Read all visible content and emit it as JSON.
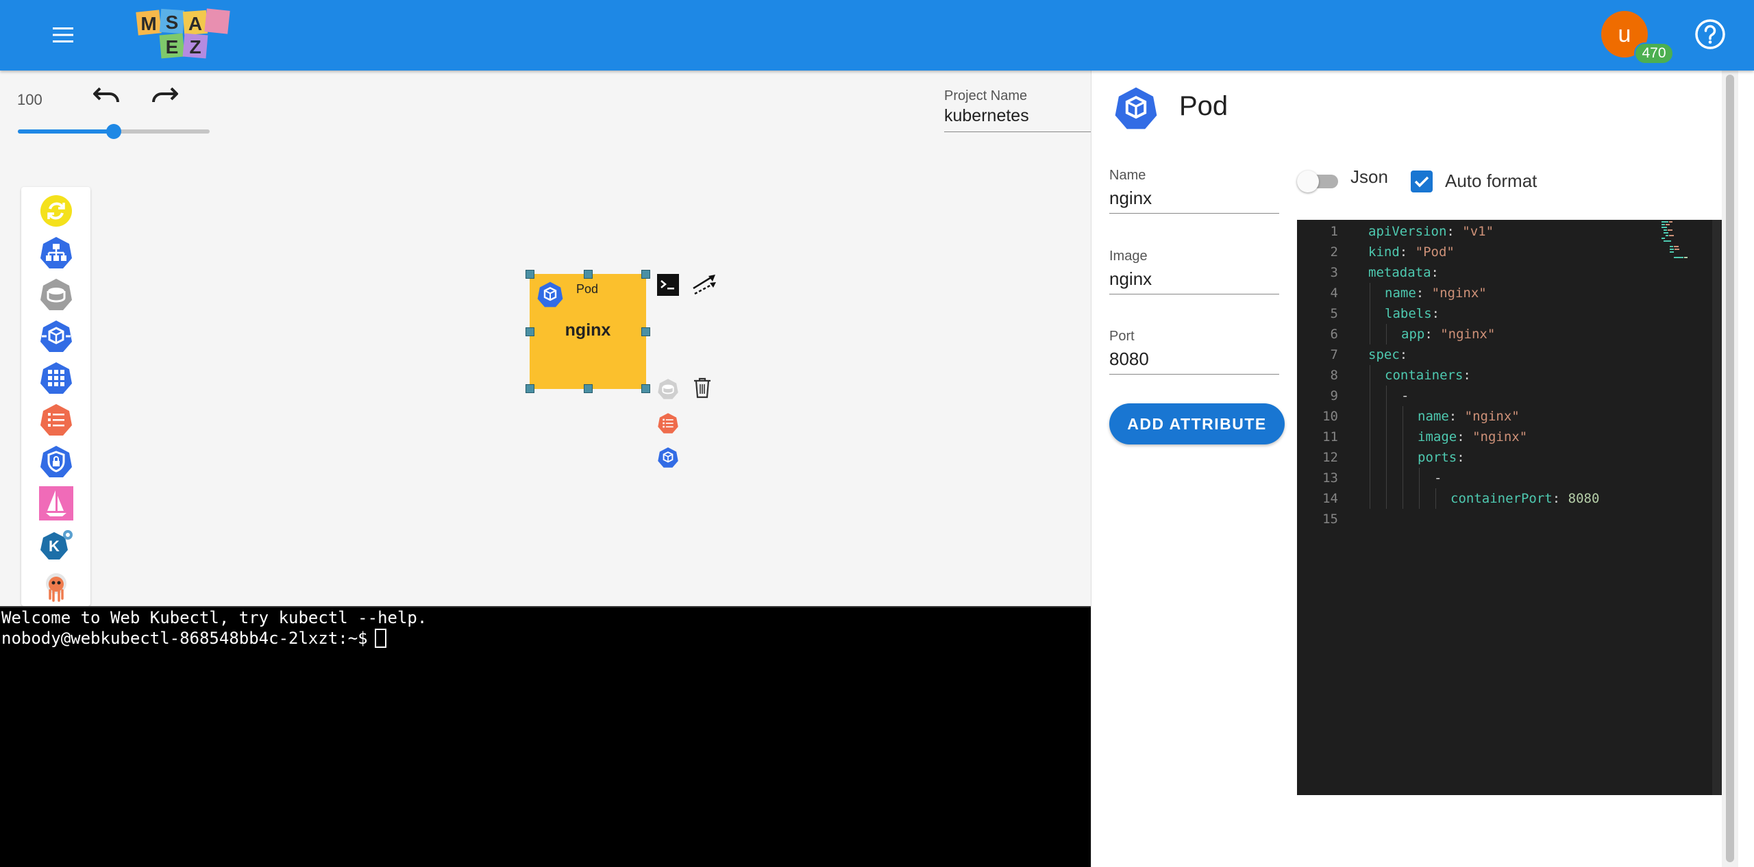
{
  "header": {
    "logo_letters": [
      "M",
      "S",
      "A",
      "E",
      "Z"
    ],
    "avatar_letter": "u",
    "avatar_badge": "470",
    "icons": {
      "menu": "hamburger-menu-icon",
      "help": "help-circle-icon"
    }
  },
  "toolbar": {
    "zoom_value": "100",
    "zoom_level": 0.5,
    "icons": {
      "undo": "undo-icon",
      "redo": "redo-icon"
    }
  },
  "project": {
    "label": "Project Name",
    "value": "kubernetes"
  },
  "palette": {
    "items": [
      {
        "icon": "sync-circle-icon",
        "color": "#f4e11c"
      },
      {
        "icon": "network-tree-icon",
        "color": "#326ce5"
      },
      {
        "icon": "database-icon",
        "color": "#9e9e9e"
      },
      {
        "icon": "kube-cube-icon",
        "color": "#326ce5"
      },
      {
        "icon": "grid-apps-icon",
        "color": "#326ce5"
      },
      {
        "icon": "list-config-icon",
        "color": "#ef6c4c"
      },
      {
        "icon": "shield-lock-icon",
        "color": "#326ce5"
      },
      {
        "icon": "sailboat-icon",
        "color": "#f06bb8"
      },
      {
        "icon": "knative-k-icon",
        "color": "#326ce5"
      },
      {
        "icon": "argo-octopus-icon",
        "color": "#ef7b4d"
      }
    ]
  },
  "canvas": {
    "node": {
      "type_label": "Pod",
      "name": "nginx",
      "fill": "#fbc02d"
    },
    "node_tools": [
      "terminal-icon",
      "connector-arrow-icon",
      "database-icon",
      "trash-icon",
      "list-config-icon",
      "kube-cube-icon"
    ]
  },
  "terminal": {
    "lines": [
      "Welcome to Web Kubectl, try kubectl --help.",
      "nobody@webkubectl-868548bb4c-2lxzt:~$"
    ]
  },
  "panel": {
    "title": "Pod",
    "icons": {
      "info": "info-icon",
      "close": "close-icon"
    },
    "fields": [
      {
        "label": "Name",
        "value": "nginx"
      },
      {
        "label": "Image",
        "value": "nginx"
      },
      {
        "label": "Port",
        "value": "8080"
      }
    ],
    "add_attribute_label": "ADD ATTRIBUTE",
    "json_toggle_label": "Json",
    "json_on": false,
    "auto_format_label": "Auto format",
    "auto_format_checked": true
  },
  "editor": {
    "lines": [
      {
        "n": "1",
        "indent": 0,
        "key": "apiVersion",
        "val": "\"v1\"",
        "vtype": "s"
      },
      {
        "n": "2",
        "indent": 0,
        "key": "kind",
        "val": "\"Pod\"",
        "vtype": "s"
      },
      {
        "n": "3",
        "indent": 0,
        "key": "metadata",
        "val": "",
        "vtype": ""
      },
      {
        "n": "4",
        "indent": 1,
        "key": "name",
        "val": "\"nginx\"",
        "vtype": "s"
      },
      {
        "n": "5",
        "indent": 1,
        "key": "labels",
        "val": "",
        "vtype": ""
      },
      {
        "n": "6",
        "indent": 2,
        "key": "app",
        "val": "\"nginx\"",
        "vtype": "s"
      },
      {
        "n": "7",
        "indent": 0,
        "key": "spec",
        "val": "",
        "vtype": ""
      },
      {
        "n": "8",
        "indent": 1,
        "key": "containers",
        "val": "",
        "vtype": ""
      },
      {
        "n": "9",
        "indent": 2,
        "key": "",
        "val": "-",
        "vtype": "p"
      },
      {
        "n": "10",
        "indent": 3,
        "key": "name",
        "val": "\"nginx\"",
        "vtype": "s"
      },
      {
        "n": "11",
        "indent": 3,
        "key": "image",
        "val": "\"nginx\"",
        "vtype": "s"
      },
      {
        "n": "12",
        "indent": 3,
        "key": "ports",
        "val": "",
        "vtype": ""
      },
      {
        "n": "13",
        "indent": 4,
        "key": "",
        "val": "-",
        "vtype": "p"
      },
      {
        "n": "14",
        "indent": 5,
        "key": "containerPort",
        "val": "8080",
        "vtype": "n"
      },
      {
        "n": "15",
        "indent": 0,
        "key": "",
        "val": "",
        "vtype": ""
      }
    ]
  },
  "colors": {
    "primary": "#1e88e5",
    "button": "#1976d2",
    "avatar": "#ef6c00",
    "badge": "#4caf50",
    "pod": "#fbc02d",
    "kube_blue": "#326ce5"
  }
}
